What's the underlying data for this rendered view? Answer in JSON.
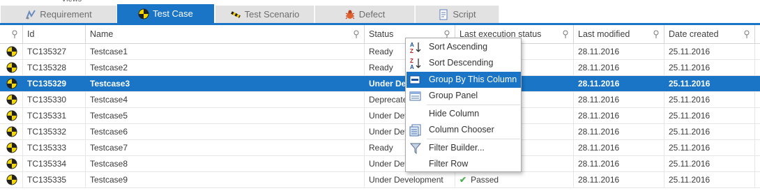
{
  "tabs": [
    {
      "label": "Requirement",
      "icon": "requirement-icon",
      "active": false
    },
    {
      "label": "Test Case",
      "icon": "test-case-icon",
      "active": true
    },
    {
      "label": "Test Scenario",
      "icon": "test-scenario-icon",
      "active": false
    },
    {
      "label": "Defect",
      "icon": "defect-bug-icon",
      "active": false
    },
    {
      "label": "Script",
      "icon": "script-icon",
      "active": false
    }
  ],
  "columns": [
    "Id",
    "Name",
    "Status",
    "Last execution status",
    "Last modified",
    "Date created"
  ],
  "rows": [
    {
      "id": "TC135327",
      "name": "Testcase1",
      "status": "Ready",
      "last_exec": "",
      "modified": "28.11.2016",
      "created": "25.11.2016"
    },
    {
      "id": "TC135328",
      "name": "Testcase2",
      "status": "Ready",
      "last_exec": "",
      "modified": "28.11.2016",
      "created": "25.11.2016"
    },
    {
      "id": "TC135329",
      "name": "Testcase3",
      "status": "Under Dev",
      "last_exec": "",
      "modified": "28.11.2016",
      "created": "25.11.2016",
      "selected": true
    },
    {
      "id": "TC135330",
      "name": "Testcase4",
      "status": "Deprecate",
      "last_exec": "",
      "modified": "28.11.2016",
      "created": "25.11.2016"
    },
    {
      "id": "TC135331",
      "name": "Testcase5",
      "status": "Under Dev",
      "last_exec": "",
      "modified": "28.11.2016",
      "created": "25.11.2016"
    },
    {
      "id": "TC135332",
      "name": "Testcase6",
      "status": "Under Dev",
      "last_exec": "",
      "modified": "28.11.2016",
      "created": "25.11.2016"
    },
    {
      "id": "TC135333",
      "name": "Testcase7",
      "status": "Ready",
      "last_exec": "",
      "modified": "28.11.2016",
      "created": "25.11.2016"
    },
    {
      "id": "TC135334",
      "name": "Testcase8",
      "status": "Under Dev",
      "last_exec": "",
      "modified": "28.11.2016",
      "created": "25.11.2016"
    },
    {
      "id": "TC135335",
      "name": "Testcase9",
      "status": "Under Development",
      "last_exec": "Passed",
      "modified": "28.11.2016",
      "created": "25.11.2016"
    }
  ],
  "context_menu": {
    "items": [
      {
        "label": "Sort Ascending",
        "icon": "sort-ascending-icon"
      },
      {
        "label": "Sort Descending",
        "icon": "sort-descending-icon"
      },
      {
        "label": "Group By This Column",
        "icon": "group-by-column-icon",
        "highlighted": true
      },
      {
        "label": "Group Panel",
        "icon": "group-panel-icon"
      },
      {
        "label": "Hide Column",
        "icon": ""
      },
      {
        "label": "Column Chooser",
        "icon": "column-chooser-icon"
      },
      {
        "label": "Filter Builder...",
        "icon": "filter-icon"
      },
      {
        "label": "Filter Row",
        "icon": ""
      }
    ]
  },
  "colors": {
    "accent": "#1a75c6",
    "passed": "#4caf50"
  }
}
